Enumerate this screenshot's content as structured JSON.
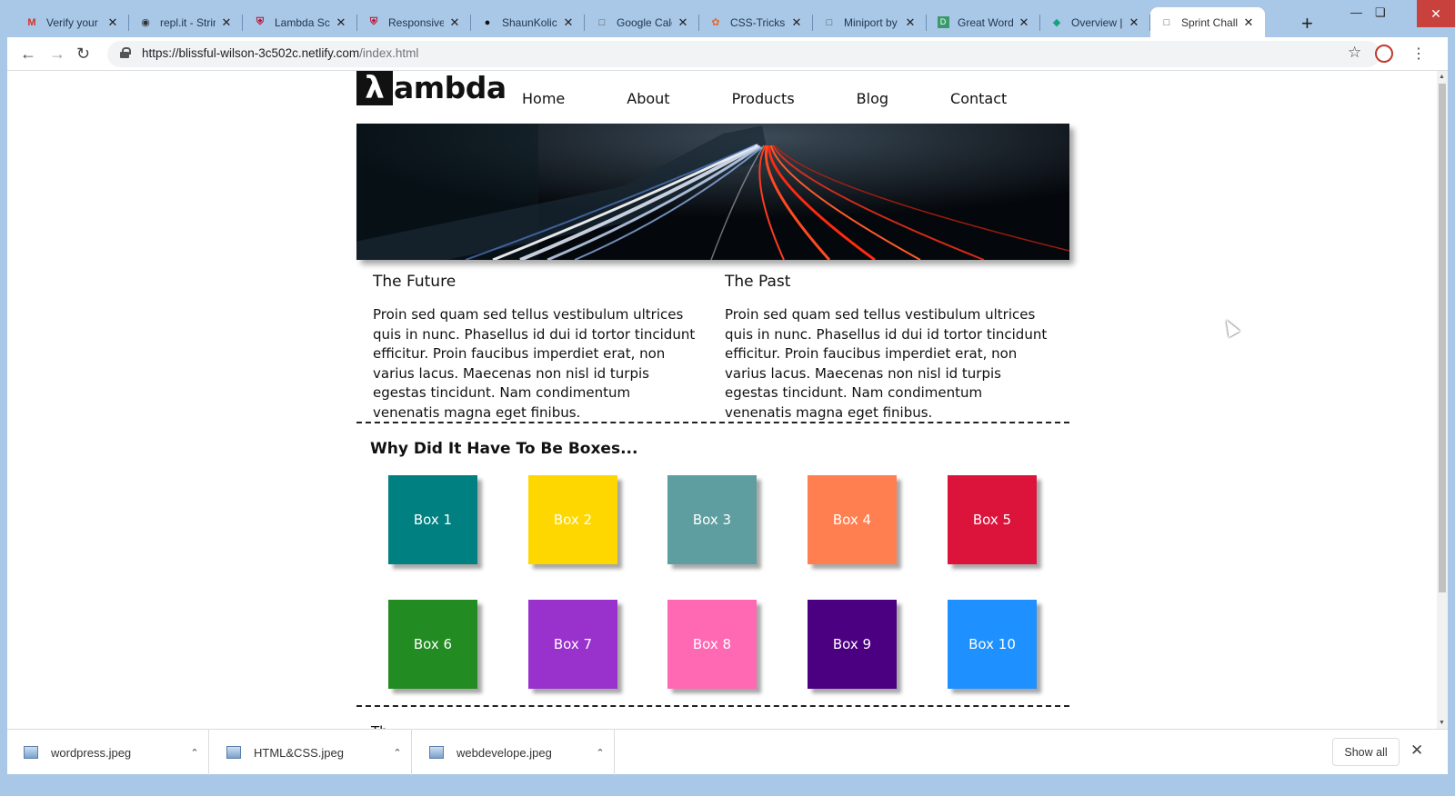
{
  "browser": {
    "tabs": [
      {
        "title": "Verify your",
        "icon": "gmail-icon",
        "active": false
      },
      {
        "title": "repl.it - Strin",
        "icon": "replit-icon",
        "active": false
      },
      {
        "title": "Lambda Sch",
        "icon": "lambda-shield-icon",
        "active": false
      },
      {
        "title": "Responsive",
        "icon": "lambda-shield-icon",
        "active": false
      },
      {
        "title": "ShaunKolich",
        "icon": "github-icon",
        "active": false
      },
      {
        "title": "Google Cale",
        "icon": "page-icon",
        "active": false
      },
      {
        "title": "CSS-Tricks",
        "icon": "css-tricks-icon",
        "active": false
      },
      {
        "title": "Miniport by",
        "icon": "page-icon",
        "active": false
      },
      {
        "title": "Great Word",
        "icon": "d-icon",
        "active": false
      },
      {
        "title": "Overview | L",
        "icon": "diamond-icon",
        "active": false
      },
      {
        "title": "Sprint Chall",
        "icon": "page-icon",
        "active": true
      }
    ],
    "url_host": "https://blissful-wilson-3c502c.netlify.com",
    "url_path": "/index.html"
  },
  "site": {
    "logo_mark": "λ",
    "logo_text": "ambda",
    "nav": [
      "Home",
      "About",
      "Products",
      "Blog",
      "Contact"
    ],
    "future_title": "The Future",
    "future_text": "Proin sed quam sed tellus vestibulum ultrices quis in nunc. Phasellus id dui id tortor tincidunt efficitur. Proin faucibus imperdiet erat, non varius lacus. Maecenas non nisl id turpis egestas tincidunt. Nam condimentum venenatis magna eget finibus.",
    "past_title": "The Past",
    "past_text": "Proin sed quam sed tellus vestibulum ultrices quis in nunc. Phasellus id dui id tortor tincidunt efficitur. Proin faucibus imperdiet erat, non varius lacus. Maecenas non nisl id turpis egestas tincidunt. Nam condimentum venenatis magna eget finibus.",
    "boxes_title": "Why Did It Have To Be Boxes...",
    "boxes": [
      {
        "label": "Box 1",
        "color": "#008080"
      },
      {
        "label": "Box 2",
        "color": "#ffd700"
      },
      {
        "label": "Box 3",
        "color": "#5f9ea0"
      },
      {
        "label": "Box 4",
        "color": "#ff7f50"
      },
      {
        "label": "Box 5",
        "color": "#dc143c"
      },
      {
        "label": "Box 6",
        "color": "#228b22"
      },
      {
        "label": "Box 7",
        "color": "#9932cc"
      },
      {
        "label": "Box 8",
        "color": "#ff69b4"
      },
      {
        "label": "Box 9",
        "color": "#4b0082"
      },
      {
        "label": "Box 10",
        "color": "#1e90ff"
      }
    ]
  },
  "downloads": {
    "items": [
      "wordpress.jpeg",
      "HTML&CSS.jpeg",
      "webdevelope.jpeg"
    ],
    "show_all": "Show all"
  }
}
